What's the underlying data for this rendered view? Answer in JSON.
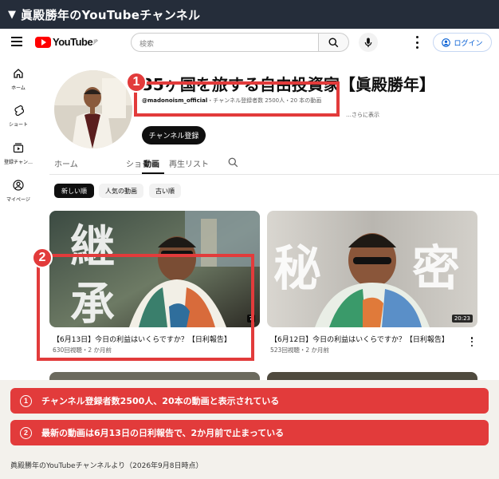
{
  "page_title": "眞殿勝年のYouTubeチャンネル",
  "youtube": {
    "logo_text": "YouTube",
    "logo_region": "JP",
    "search": {
      "placeholder": "検索"
    },
    "login_label": "ログイン",
    "sidebar": [
      {
        "label": "ホーム",
        "icon": "home-icon"
      },
      {
        "label": "ショート",
        "icon": "shorts-icon"
      },
      {
        "label": "登録チャン…",
        "icon": "subscriptions-icon"
      },
      {
        "label": "マイページ",
        "icon": "account-icon"
      }
    ],
    "channel": {
      "title": "35ヶ国を旅する自由投資家【眞殿勝年】",
      "handle": "@madonoism_official",
      "stats": "・チャンネル登録者数 2500人・20 本の動画",
      "more": "…さらに表示",
      "subscribe_label": "チャンネル登録"
    },
    "tabs": [
      "ホーム",
      "動画",
      "ショート",
      "再生リスト"
    ],
    "active_tab": "動画",
    "chips": [
      "新しい順",
      "人気の動画",
      "古い順"
    ],
    "active_chip": "新しい順",
    "videos": [
      {
        "title": "【6月13日】今日の利益はいくらですか？【日利報告】",
        "meta": "630回視聴・2 か月前",
        "duration": "7",
        "overlay": [
          "継",
          "承"
        ]
      },
      {
        "title": "【6月12日】今日の利益はいくらですか？【日利報告】",
        "meta": "523回視聴・2 か月前",
        "duration": "20:23",
        "overlay": [
          "秘",
          "密"
        ]
      }
    ]
  },
  "callouts": [
    {
      "num": "1",
      "text": "チャンネル登録者数2500人、20本の動画と表示されている"
    },
    {
      "num": "2",
      "text": "最新の動画は6月13日の日利報告で、2か月前で止まっている"
    }
  ],
  "note_marks": [
    "①",
    "②"
  ],
  "source": "眞殿勝年のYouTubeチャンネルより（2026年9月8日時点）",
  "colors": {
    "accent_red": "#e23b3b",
    "header_bg": "#252d3a",
    "yt_red": "#ff0000",
    "link_blue": "#065fd4"
  }
}
